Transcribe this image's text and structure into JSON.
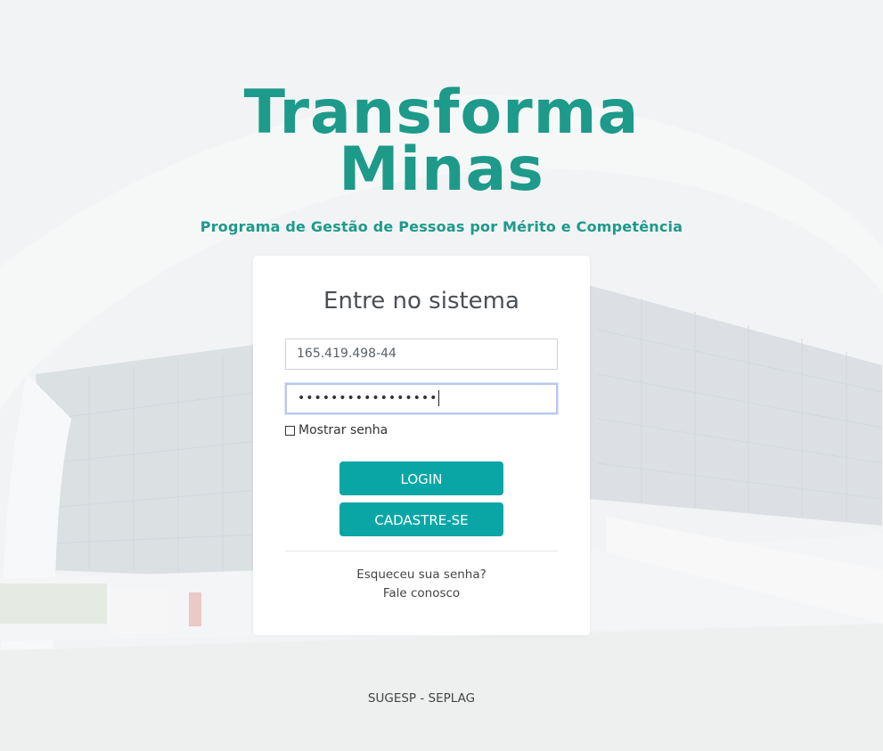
{
  "brand": {
    "title_line1": "Transforma",
    "title_line2": "Minas",
    "subtitle": "Programa de Gestão de Pessoas por Mérito e Competência",
    "color": "#1d9a8a"
  },
  "login": {
    "title": "Entre no sistema",
    "username_value": "165.419.498-44",
    "password_mask": "•••••••••••••••••",
    "show_password_label": "Mostrar senha",
    "show_password_checked": false,
    "login_button": "LOGIN",
    "signup_button": "CADASTRE-SE",
    "forgot_password_link": "Esqueceu sua senha?",
    "contact_link": "Fale conosco",
    "button_color": "#0aa6a6"
  },
  "footer": {
    "text": "SUGESP - SEPLAG"
  }
}
